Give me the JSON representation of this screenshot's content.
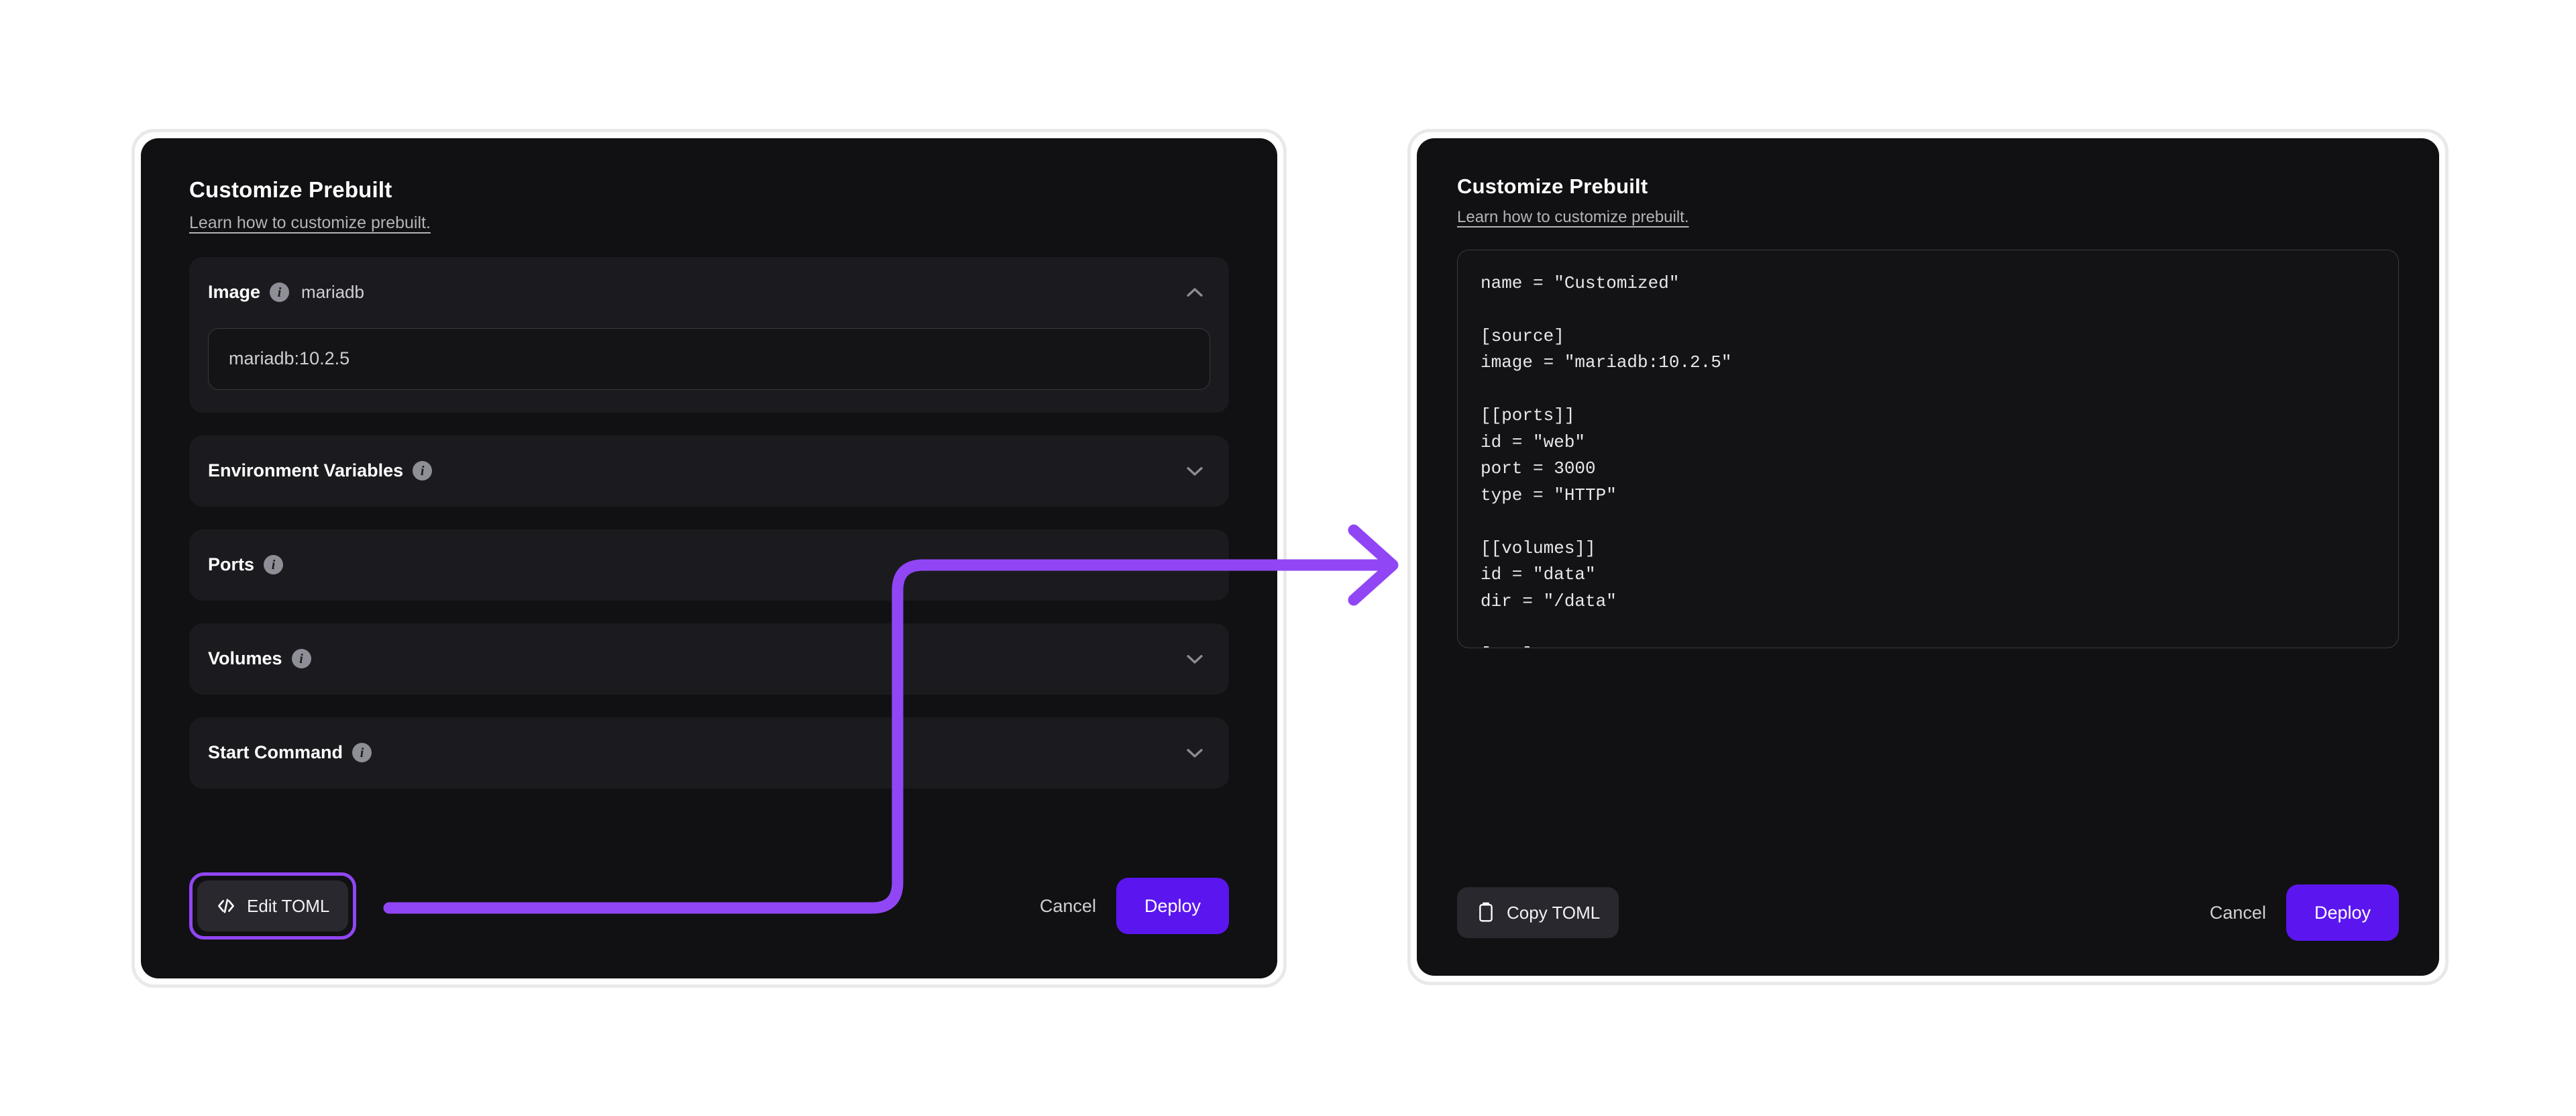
{
  "accent": {
    "arrow_purple": "#9146f5",
    "deploy_blue_violet": "#5b16f0",
    "card_bg": "#111113",
    "row_bg": "#1b1b1f",
    "page_bg": "#ffffff"
  },
  "left_panel": {
    "title": "Customize Prebuilt",
    "subtitle_link": "Learn how to customize prebuilt.",
    "sections": [
      {
        "label": "Image",
        "value": "mariadb",
        "state": "expanded",
        "chevron": "chevron-up-icon",
        "input_value": "mariadb:10.2.5",
        "input_placeholder": "mariadb:10.2.5"
      },
      {
        "label": "Environment Variables",
        "value": "",
        "state": "collapsed",
        "chevron": "chevron-down-icon"
      },
      {
        "label": "Ports",
        "value": "",
        "state": "collapsed",
        "chevron": "chevron-down-icon"
      },
      {
        "label": "Volumes",
        "value": "",
        "state": "collapsed",
        "chevron": "chevron-down-icon"
      },
      {
        "label": "Start Command",
        "value": "",
        "state": "collapsed",
        "chevron": "chevron-down-icon"
      }
    ],
    "footer": {
      "edit_toml_label": "Edit TOML",
      "edit_toml_icon": "code-brackets-icon",
      "edit_toml_highlighted": true,
      "cancel_label": "Cancel",
      "deploy_label": "Deploy"
    }
  },
  "right_panel": {
    "title": "Customize Prebuilt",
    "subtitle_link": "Learn how to customize prebuilt.",
    "toml": "name = \"Customized\"\n\n[source]\nimage = \"mariadb:10.2.5\"\n\n[[ports]]\nid = \"web\"\nport = 3000\ntype = \"HTTP\"\n\n[[volumes]]\nid = \"data\"\ndir = \"/data\"\n\n[env]\nMARIADB_USER = { default = \"zeabur\" }\n\nMARIADB_PASSWORD = { default = \"${MARIADB_ROOT_PASSWORD}\" , readonly = true , expose = true }",
    "footer": {
      "copy_toml_label": "Copy TOML",
      "copy_toml_icon": "clipboard-icon",
      "cancel_label": "Cancel",
      "deploy_label": "Deploy"
    }
  },
  "annotation": {
    "arrow_name": "edit-toml-to-toml-view-arrow",
    "arrow_color": "#9146f5"
  }
}
